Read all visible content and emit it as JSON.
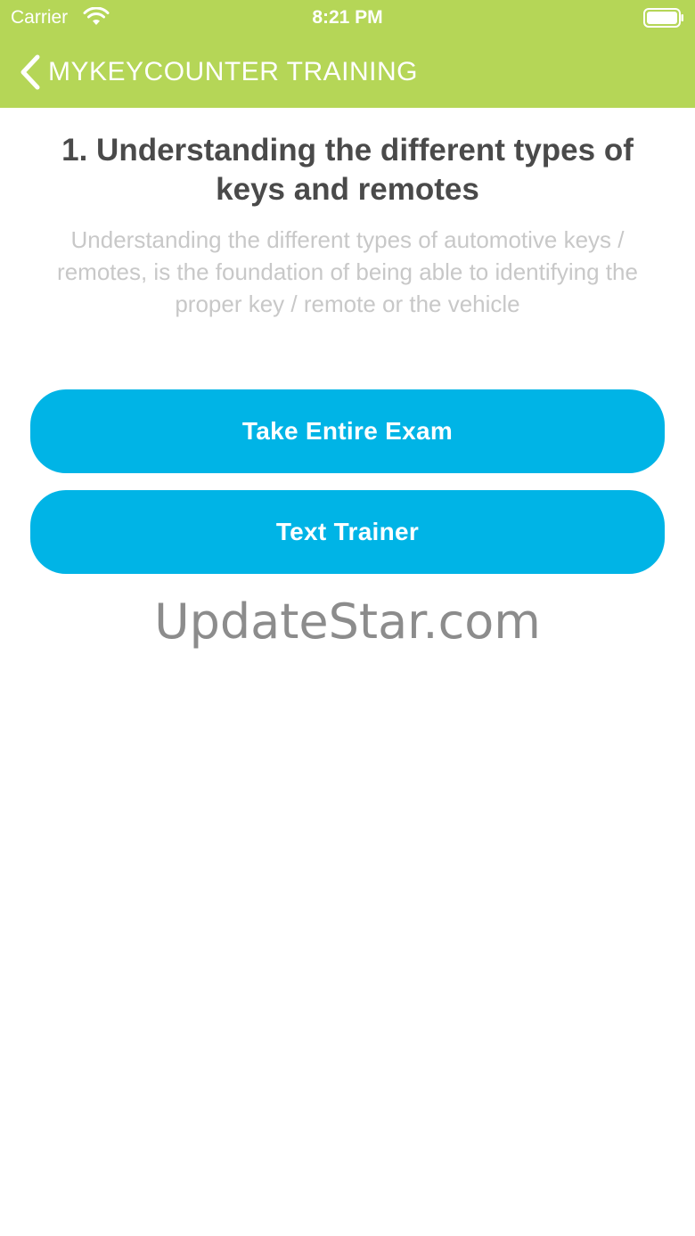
{
  "status_bar": {
    "carrier": "Carrier",
    "time": "8:21 PM",
    "wifi_icon": "wifi-icon",
    "battery_icon": "battery-icon"
  },
  "nav": {
    "back_icon": "chevron-left-icon",
    "title": "MYKEYCOUNTER TRAINING"
  },
  "lesson": {
    "title": "1. Understanding the different types of keys and remotes",
    "description": "Understanding the different types of automotive keys / remotes, is the foundation of being able to identifying the proper key / remote or the vehicle"
  },
  "actions": {
    "exam_label": "Take Entire Exam",
    "trainer_label": "Text Trainer"
  },
  "watermark": "UpdateStar.com",
  "colors": {
    "header": "#b5d657",
    "button": "#00b4e6",
    "title_text": "#4a4a4a",
    "description_text": "#c8c8c8"
  }
}
